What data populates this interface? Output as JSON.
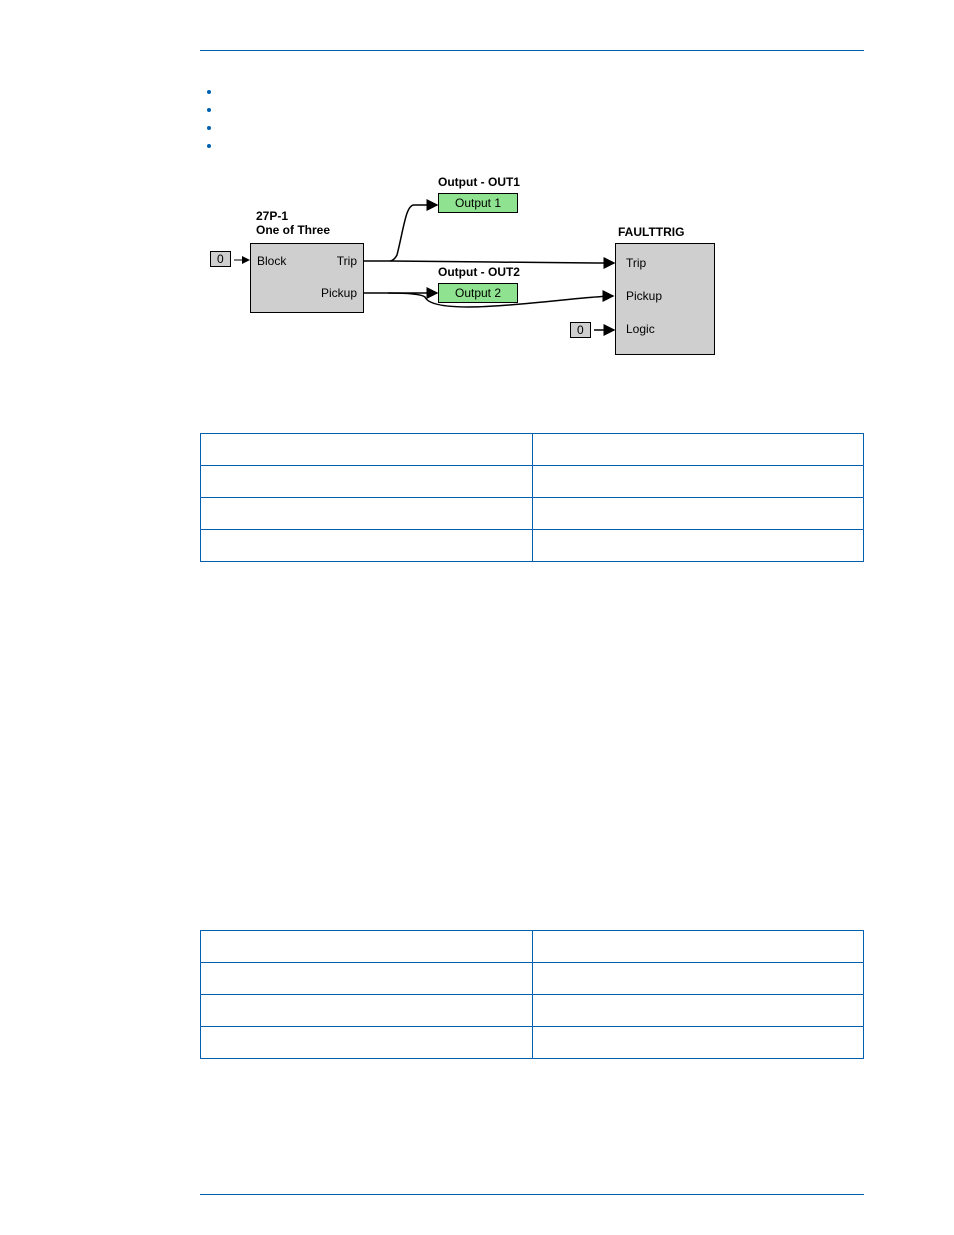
{
  "bullets": [
    "",
    "",
    "",
    ""
  ],
  "diagram": {
    "block27": {
      "title1": "27P-1",
      "title2": "One of Three",
      "port_block": "Block",
      "port_trip": "Trip",
      "port_pickup": "Pickup"
    },
    "out1": {
      "label": "Output - OUT1",
      "box": "Output 1"
    },
    "out2": {
      "label": "Output - OUT2",
      "box": "Output 2"
    },
    "fault": {
      "title": "FAULTTRIG",
      "port_trip": "Trip",
      "port_pickup": "Pickup",
      "port_logic": "Logic"
    },
    "zero": "0"
  },
  "table1": {
    "rows": [
      [
        "",
        ""
      ],
      [
        "",
        ""
      ],
      [
        "",
        ""
      ],
      [
        "",
        ""
      ]
    ]
  },
  "table2": {
    "rows": [
      [
        "",
        ""
      ],
      [
        "",
        ""
      ],
      [
        "",
        ""
      ],
      [
        "",
        ""
      ]
    ]
  }
}
